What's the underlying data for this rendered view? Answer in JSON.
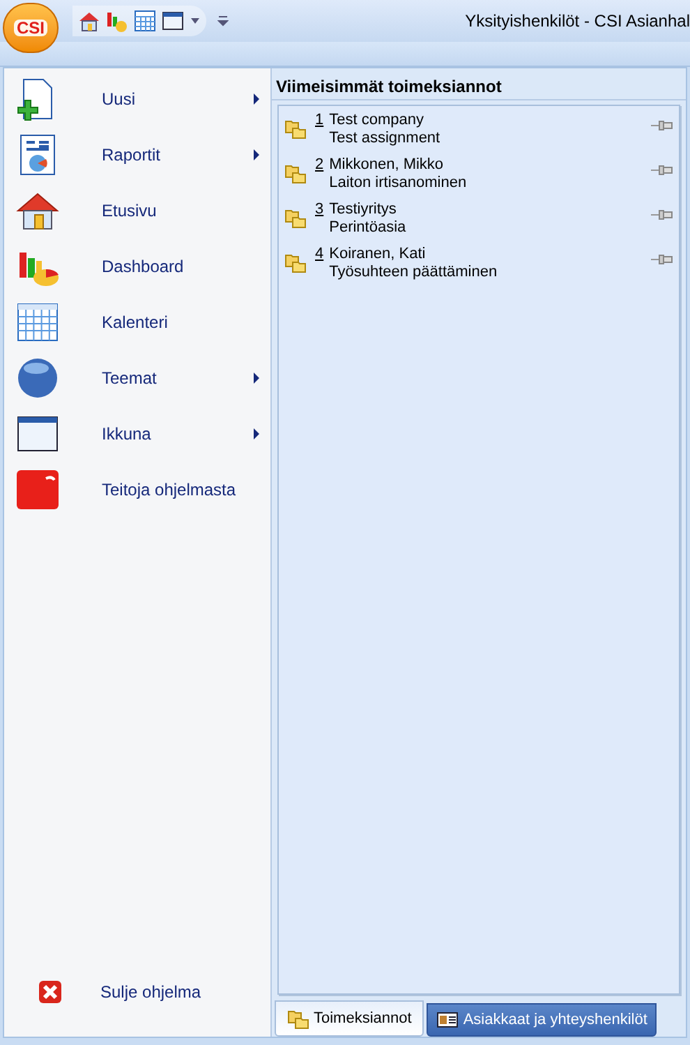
{
  "window": {
    "title": "Yksityishenkilöt - CSI Asianhal"
  },
  "app_button": {
    "label": "CSI"
  },
  "menu": {
    "items": [
      {
        "label": "Uusi",
        "submenu": true
      },
      {
        "label": "Raportit",
        "submenu": true
      },
      {
        "label": "Etusivu",
        "submenu": false
      },
      {
        "label": "Dashboard",
        "submenu": false
      },
      {
        "label": "Kalenteri",
        "submenu": false
      },
      {
        "label": "Teemat",
        "submenu": true
      },
      {
        "label": "Ikkuna",
        "submenu": true
      },
      {
        "label": "Teitoja ohjelmasta",
        "submenu": false
      }
    ],
    "exit": {
      "label": "Sulje ohjelma"
    }
  },
  "recent": {
    "title": "Viimeisimmät toimeksiannot",
    "items": [
      {
        "number": "1",
        "name": "Test company",
        "subtitle": "Test assignment"
      },
      {
        "number": "2",
        "name": "Mikkonen, Mikko",
        "subtitle": "Laiton irtisanominen"
      },
      {
        "number": "3",
        "name": "Testiyritys",
        "subtitle": "Perintöasia"
      },
      {
        "number": "4",
        "name": "Koiranen, Kati",
        "subtitle": "Työsuhteen päättäminen"
      }
    ]
  },
  "tabs": [
    {
      "label": "Toimeksiannot",
      "selected": true
    },
    {
      "label": "Asiakkaat ja yhteyshenkilöt",
      "selected": false
    }
  ]
}
